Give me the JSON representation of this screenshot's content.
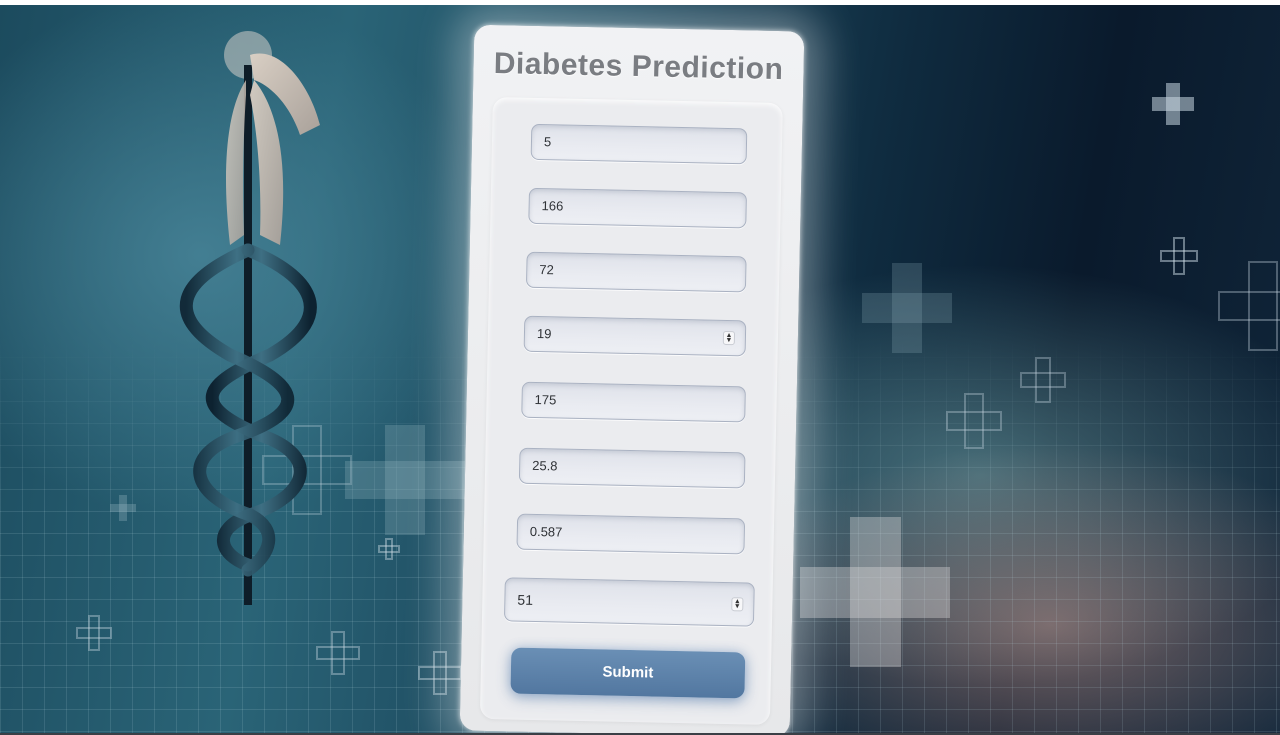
{
  "form": {
    "title": "Diabetes Prediction",
    "fields": [
      {
        "value": "5",
        "type": "text"
      },
      {
        "value": "166",
        "type": "text"
      },
      {
        "value": "72",
        "type": "text"
      },
      {
        "value": "19",
        "type": "number"
      },
      {
        "value": "175",
        "type": "text"
      },
      {
        "value": "25.8",
        "type": "text"
      },
      {
        "value": "0.587",
        "type": "text"
      },
      {
        "value": "51",
        "type": "number"
      }
    ],
    "submit_label": "Submit",
    "spinner_glyph": "▲▼"
  },
  "colors": {
    "background_dark": "#0f2b3f",
    "background_teal": "#2a6477",
    "card": "#ebecef",
    "title": "#7a7d82",
    "submit": "#5a7fa8"
  },
  "icons": [
    "caduceus-icon",
    "medical-cross-icon"
  ]
}
